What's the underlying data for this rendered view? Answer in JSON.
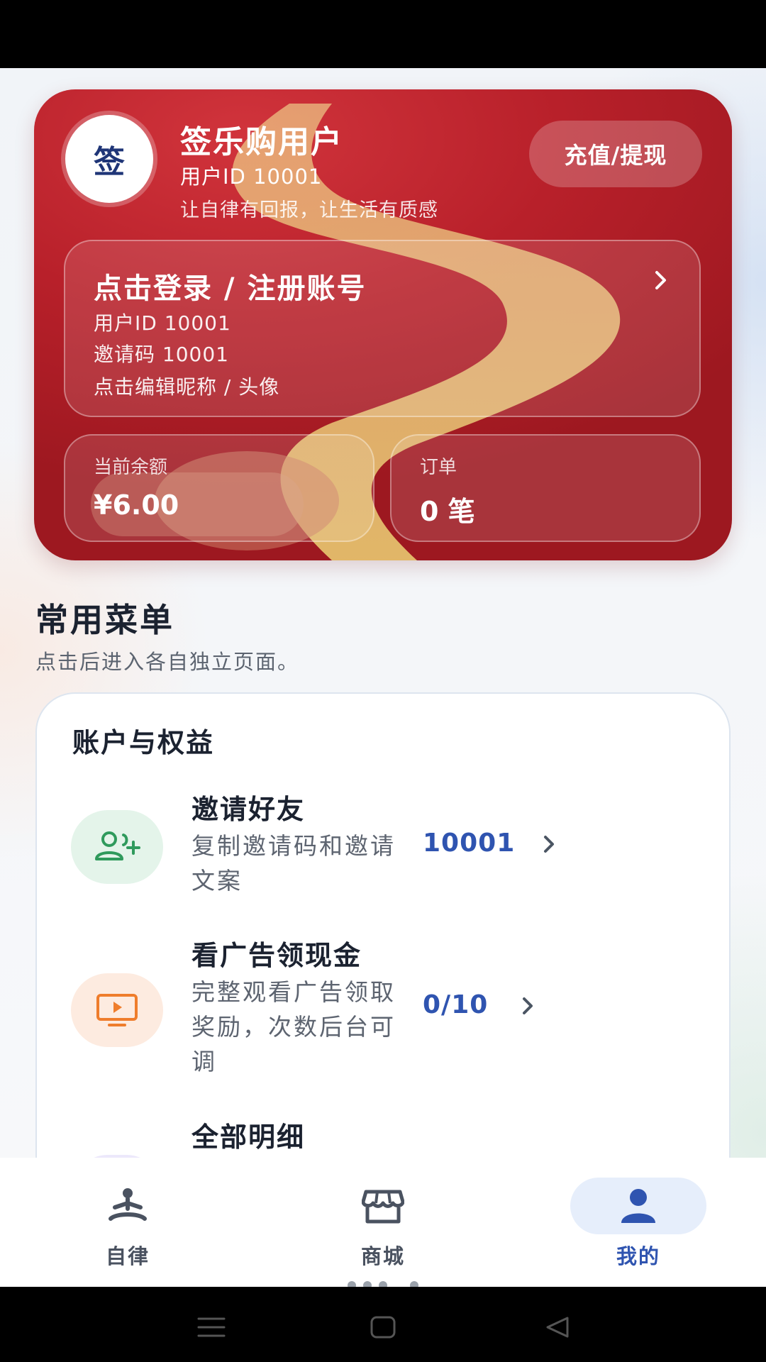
{
  "profile": {
    "avatar_char": "签",
    "name": "签乐购用户",
    "user_id_text": "用户ID 10001",
    "slogan": "让自律有回报，让生活有质感",
    "recharge_label": "充值/提现"
  },
  "login": {
    "title": "点击登录 / 注册账号",
    "user_id_text": "用户ID  10001",
    "invite_code_text": "邀请码  10001",
    "edit_hint": "点击编辑昵称 / 头像"
  },
  "stats": {
    "balance_label": "当前余额",
    "balance_value": "¥6.00",
    "orders_label": "订单",
    "orders_value": "0 笔"
  },
  "menu_section": {
    "title": "常用菜单",
    "subtitle": "点击后进入各自独立页面。",
    "group_title": "账户与权益",
    "items": [
      {
        "name": "邀请好友",
        "desc": "复制邀请码和邀请文案",
        "value": "10001",
        "icon": "add-user-icon",
        "color": "#2f9a5c"
      },
      {
        "name": "看广告领现金",
        "desc": "完整观看广告领取奖励，次数后台可调",
        "value": "0/10",
        "icon": "play-screen-icon",
        "color": "#ef7d2c"
      },
      {
        "name": "全部明细",
        "desc": "",
        "value": "",
        "icon": "list-icon",
        "color": "#7a68d8"
      }
    ]
  },
  "bottom_nav": {
    "items": [
      {
        "label": "自律",
        "icon": "meditation-icon"
      },
      {
        "label": "商城",
        "icon": "store-icon"
      },
      {
        "label": "我的",
        "icon": "person-icon",
        "active": true
      }
    ],
    "active_color": "#2f54b0"
  }
}
